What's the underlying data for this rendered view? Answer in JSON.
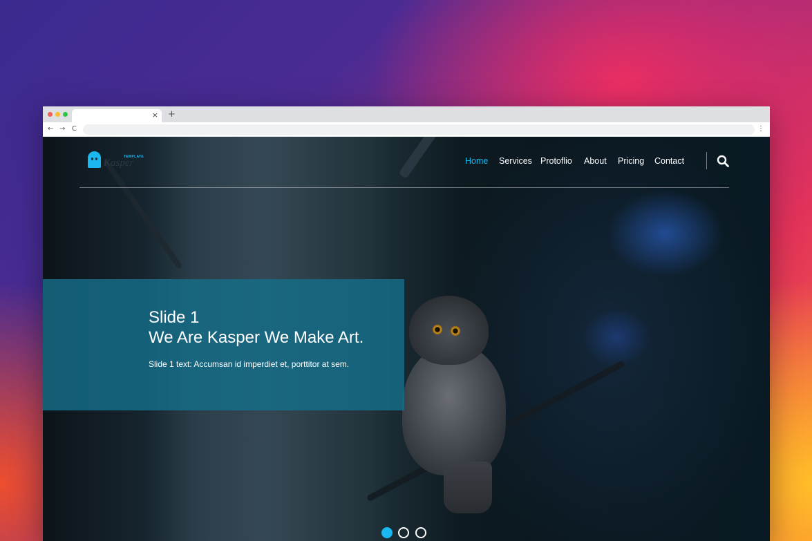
{
  "browser": {
    "tab_close": "×",
    "new_tab": "+",
    "back": "←",
    "forward": "→",
    "reload": "C",
    "address": "",
    "menu": "⋮"
  },
  "header": {
    "logo_tag": "TEMPLATE",
    "logo_word": "Kasper",
    "nav": [
      {
        "label": "Home",
        "active": true
      },
      {
        "label": "Services",
        "active": false
      },
      {
        "label": "Protoflio",
        "active": false
      },
      {
        "label": "About",
        "active": false
      },
      {
        "label": "Pricing",
        "active": false
      },
      {
        "label": "Contact",
        "active": false
      }
    ],
    "search_icon": "search-icon"
  },
  "slider": {
    "title": "Slide 1",
    "subtitle": "We Are Kasper We Make Art.",
    "text": "Slide 1 text: Accumsan id imperdiet et, porttitor at sem.",
    "active_index": 0,
    "count": 3
  },
  "colors": {
    "accent": "#1ab8ee",
    "panel": "#156e8a"
  }
}
